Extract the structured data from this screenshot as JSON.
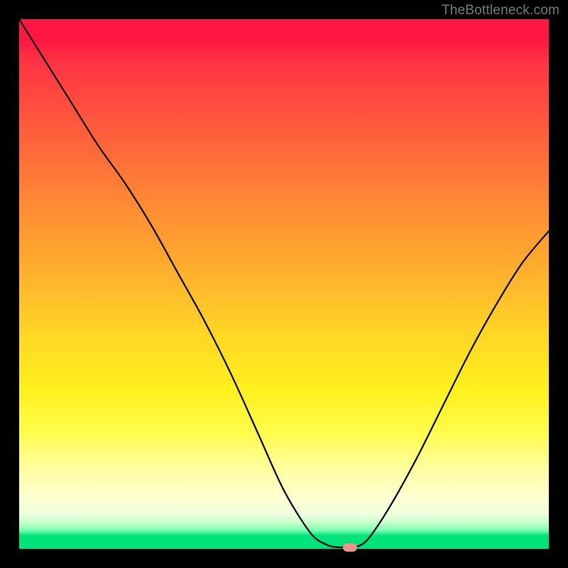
{
  "watermark": "TheBottleneck.com",
  "chart_data": {
    "type": "line",
    "title": "",
    "xlabel": "",
    "ylabel": "",
    "xlim": [
      0,
      100
    ],
    "ylim": [
      0,
      100
    ],
    "x": [
      0,
      5,
      10,
      15,
      20,
      25,
      30,
      35,
      40,
      45,
      50,
      55,
      58,
      60,
      62,
      63,
      64,
      66,
      70,
      75,
      80,
      85,
      90,
      95,
      100
    ],
    "values": [
      100,
      92,
      84,
      76,
      69,
      61,
      52,
      43,
      33,
      22,
      11,
      3,
      0.8,
      0.3,
      0.3,
      0.3,
      0.5,
      2,
      8,
      17,
      27,
      37,
      46,
      54,
      60
    ],
    "marker": {
      "x": 62.5,
      "y": 0.3
    },
    "gradient_stops": [
      {
        "pos": 0,
        "color": "#ff1744"
      },
      {
        "pos": 0.35,
        "color": "#ff8a34"
      },
      {
        "pos": 0.6,
        "color": "#ffd824"
      },
      {
        "pos": 0.84,
        "color": "#fffe96"
      },
      {
        "pos": 0.97,
        "color": "#00e37a"
      },
      {
        "pos": 1.0,
        "color": "#00e37a"
      }
    ]
  }
}
